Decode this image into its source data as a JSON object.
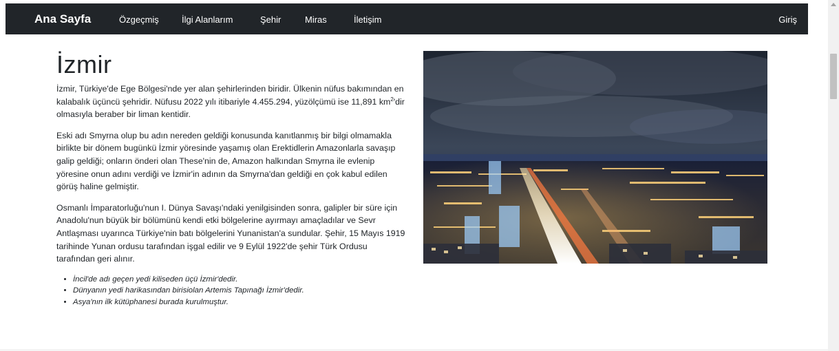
{
  "navbar": {
    "brand": "Ana Sayfa",
    "links": [
      "Özgeçmiş",
      "İlgi Alanlarım",
      "Şehir",
      "Miras",
      "İletişim"
    ],
    "login": "Giriş"
  },
  "article": {
    "title": "İzmir",
    "p1_main": "İzmir, Türkiye'de Ege Bölgesi'nde yer alan şehirlerinden biridir. Ülkenin nüfus bakımından en kalabalık üçüncü şehridir. Nüfusu 2022 yılı itibariyle 4.455.294, yüzölçümü ise 11,891 km",
    "p1_sup": "2",
    "p1_tail": "'dir olmasıyla beraber bir liman kentidir.",
    "p2": "Eski adı Smyrna olup bu adın nereden geldiği konusunda kanıtlanmış bir bilgi olmamakla birlikte bir dönem bugünkü İzmir yöresinde yaşamış olan Erektidlerin Amazonlarla savaşıp galip geldiği; onların önderi olan These'nin de, Amazon halkından Smyrna ile evlenip yöresine onun adını verdiği ve İzmir'in adının da Smyrna'dan geldiği en çok kabul edilen görüş haline gelmiştir.",
    "p3": "Osmanlı İmparatorluğu'nun I. Dünya Savaşı'ndaki yenilgisinden sonra, galipler bir süre için Anadolu'nun büyük bir bölümünü kendi etki bölgelerine ayırmayı amaçladılar ve Sevr Antlaşması uyarınca Türkiye'nin batı bölgelerini Yunanistan'a sundular. Şehir, 15 Mayıs 1919 tarihinde Yunan ordusu tarafından işgal edilir ve 9 Eylül 1922'de şehir Türk Ordusu tarafından geri alınır.",
    "facts": [
      "İncil'de adı geçen yedi kiliseden üçü İzmir'dedir.",
      "Dünyanın yedi harikasından birisiolan Artemis Tapınağı İzmir'dedir.",
      "Asya'nın ilk kütüphanesi burada kurulmuştur."
    ]
  },
  "colors": {
    "navbar_bg": "#212529",
    "text": "#212529"
  },
  "icons": {
    "scroll_up": "scroll-up-arrow-icon"
  }
}
